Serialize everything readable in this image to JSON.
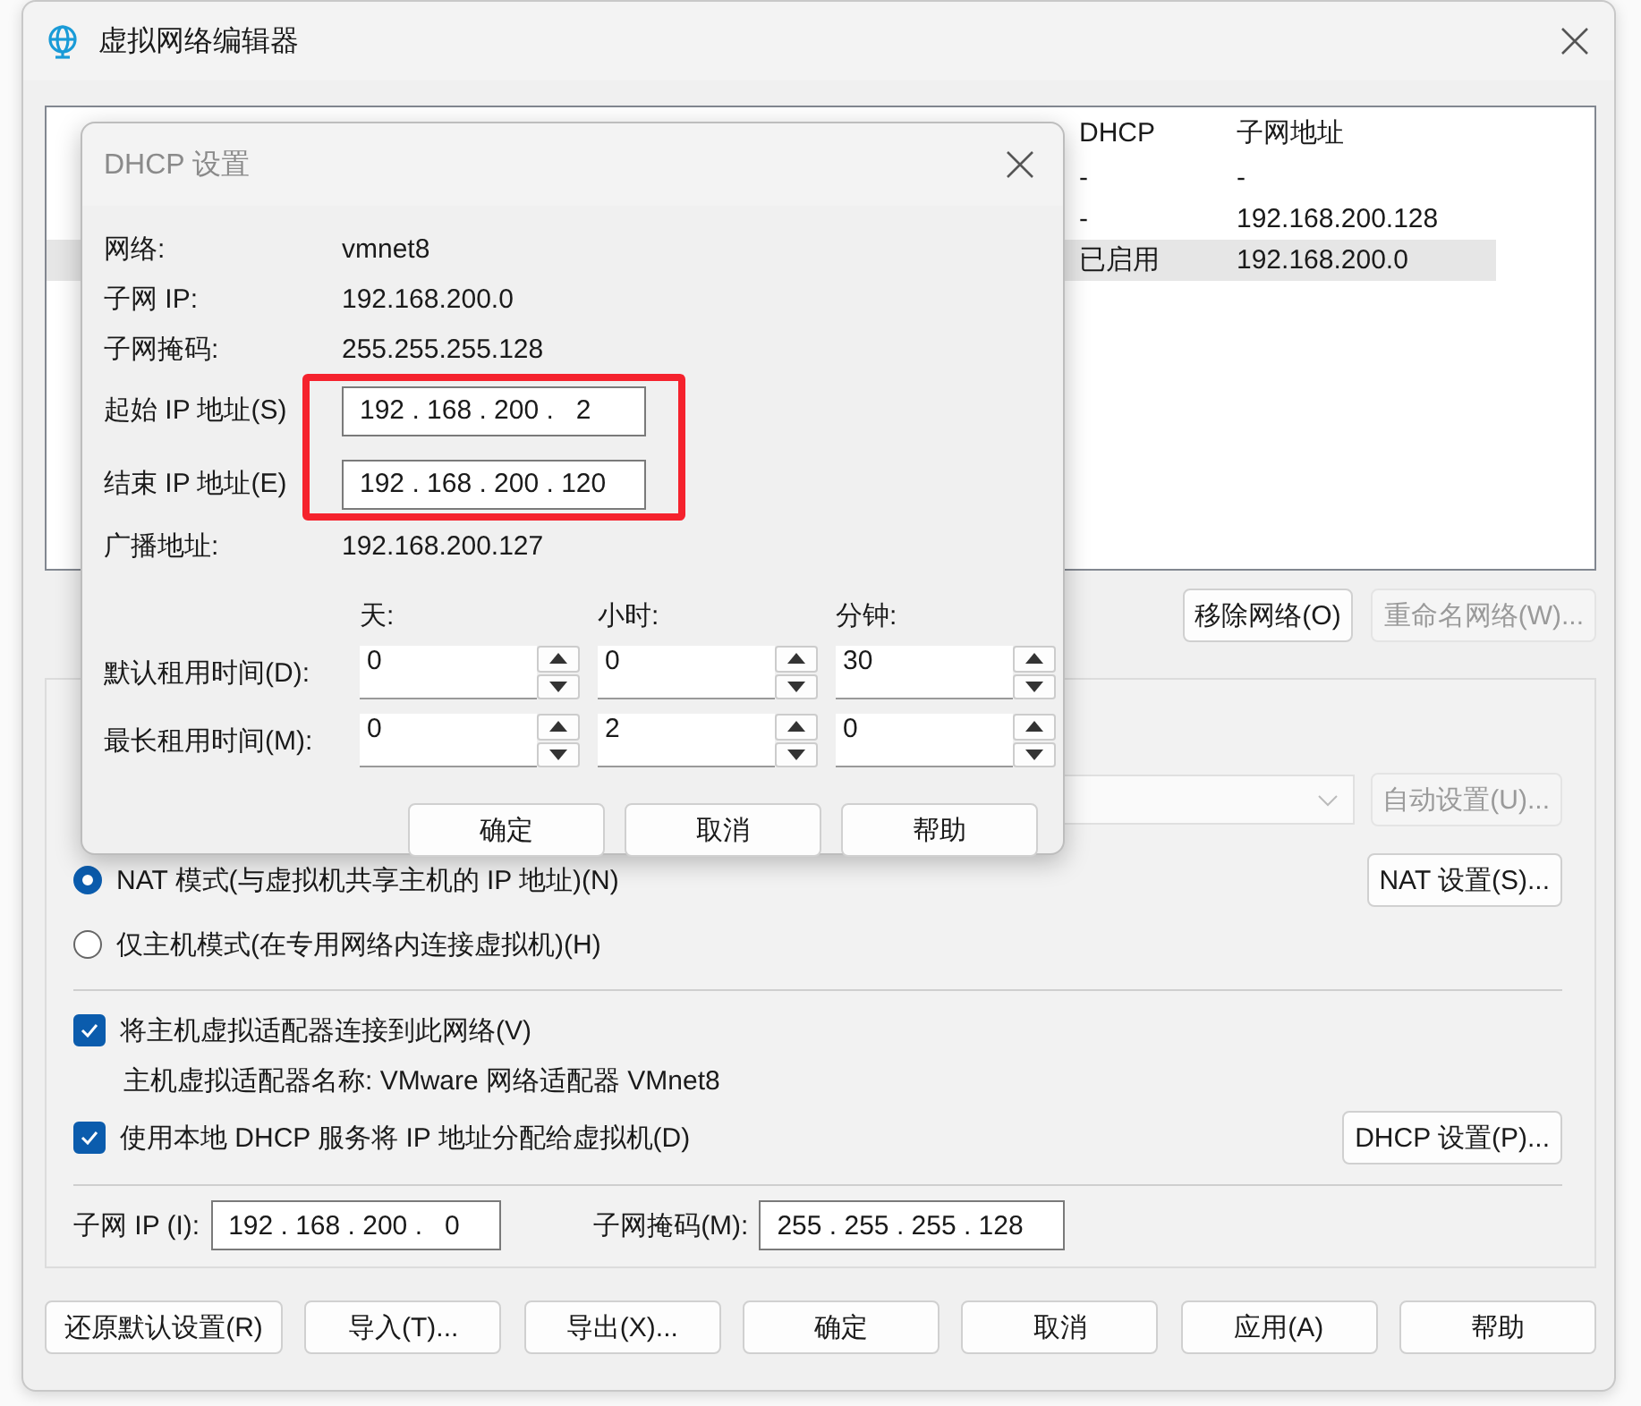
{
  "window": {
    "title": "虚拟网络编辑器"
  },
  "network_table": {
    "columns": [
      "DHCP",
      "子网地址"
    ],
    "rows": [
      {
        "cells": [
          "-",
          "-"
        ],
        "selected": false
      },
      {
        "cells": [
          "-",
          "192.168.200.128"
        ],
        "selected": false
      },
      {
        "cells": [
          "已启用",
          "192.168.200.0"
        ],
        "selected": true
      }
    ]
  },
  "network_buttons": [
    {
      "label": "移除网络(O)",
      "disabled": false
    },
    {
      "label": "重命名网络(W)...",
      "disabled": true
    }
  ],
  "adapter_dropdown": {
    "disabled": true
  },
  "auto_button": {
    "label": "自动设置(U)...",
    "disabled": true
  },
  "modes": [
    {
      "label": "NAT 模式(与虚拟机共享主机的 IP 地址)(N)",
      "selected": true,
      "button": {
        "label": "NAT 设置(S)...",
        "disabled": false
      }
    },
    {
      "label": "仅主机模式(在专用网络内连接虚拟机)(H)",
      "selected": false
    }
  ],
  "connect_adapter": {
    "label": "将主机虚拟适配器连接到此网络(V)",
    "checked": true,
    "adapter_name": "主机虚拟适配器名称: VMware 网络适配器 VMnet8"
  },
  "use_dhcp": {
    "label": "使用本地 DHCP 服务将 IP 地址分配给虚拟机(D)",
    "checked": true,
    "button": {
      "label": "DHCP 设置(P)...",
      "disabled": false
    }
  },
  "subnet_ip": {
    "label": "子网 IP (I):",
    "value": "192 . 168 . 200 .   0"
  },
  "subnet_mask": {
    "label": "子网掩码(M):",
    "value": "255 . 255 . 255 . 128"
  },
  "footer_buttons": [
    {
      "label": "还原默认设置(R)"
    },
    {
      "label": "导入(T)..."
    },
    {
      "label": "导出(X)..."
    },
    {
      "label": "确定"
    },
    {
      "label": "取消"
    },
    {
      "label": "应用(A)"
    },
    {
      "label": "帮助"
    }
  ],
  "dhcp_dialog": {
    "title": "DHCP 设置",
    "info": [
      {
        "kind": "text",
        "label": "网络:",
        "value": "vmnet8"
      },
      {
        "kind": "text",
        "label": "子网 IP:",
        "value": "192.168.200.0"
      },
      {
        "kind": "text",
        "label": "子网掩码:",
        "value": "255.255.255.128"
      },
      {
        "kind": "field",
        "label": "起始 IP 地址(S)",
        "value": "192 . 168 . 200 .   2"
      },
      {
        "kind": "field",
        "label": "结束 IP 地址(E)",
        "value": "192 . 168 . 200 . 120"
      },
      {
        "kind": "text",
        "label": "广播地址:",
        "value": "192.168.200.127"
      }
    ],
    "lease": {
      "columns": [
        "天:",
        "小时:",
        "分钟:"
      ],
      "rows": [
        {
          "label": "默认租用时间(D):",
          "values": [
            "0",
            "0",
            "30"
          ]
        },
        {
          "label": "最长租用时间(M):",
          "values": [
            "0",
            "2",
            "0"
          ]
        }
      ]
    },
    "buttons": [
      {
        "label": "确定"
      },
      {
        "label": "取消"
      },
      {
        "label": "帮助"
      }
    ]
  }
}
